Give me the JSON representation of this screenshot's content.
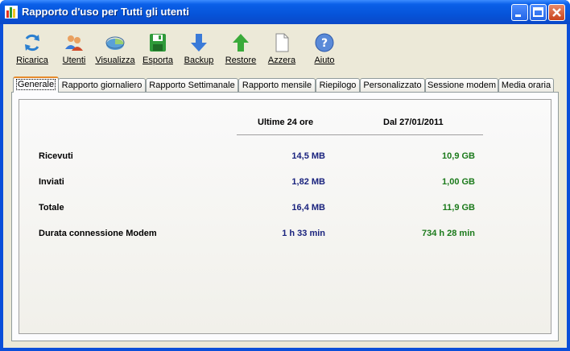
{
  "window": {
    "title": "Rapporto d'uso per Tutti gli utenti"
  },
  "toolbar": [
    {
      "label": "Ricarica",
      "icon": "refresh-icon"
    },
    {
      "label": "Utenti",
      "icon": "users-icon"
    },
    {
      "label": "Visualizza",
      "icon": "pie-chart-icon"
    },
    {
      "label": "Esporta",
      "icon": "save-icon"
    },
    {
      "label": "Backup",
      "icon": "arrow-down-icon"
    },
    {
      "label": "Restore",
      "icon": "arrow-up-icon"
    },
    {
      "label": "Azzera",
      "icon": "blank-page-icon"
    },
    {
      "label": "Aiuto",
      "icon": "help-icon"
    }
  ],
  "tabs": [
    {
      "label": "Generale",
      "active": true
    },
    {
      "label": "Rapporto giornaliero"
    },
    {
      "label": "Rapporto Settimanale"
    },
    {
      "label": "Rapporto mensile"
    },
    {
      "label": "Riepilogo"
    },
    {
      "label": "Personalizzato"
    },
    {
      "label": "Sessione modem"
    },
    {
      "label": "Media oraria"
    }
  ],
  "report": {
    "col1": "Ultime 24 ore",
    "col2": "Dal 27/01/2011",
    "rows": [
      {
        "label": "Ricevuti",
        "v1": "14,5 MB",
        "v2": "10,9 GB"
      },
      {
        "label": "Inviati",
        "v1": "1,82 MB",
        "v2": "1,00 GB"
      },
      {
        "label": "Totale",
        "v1": "16,4 MB",
        "v2": "11,9 GB"
      },
      {
        "label": "Durata connessione Modem",
        "v1": "1 h 33 min",
        "v2": "734 h 28 min"
      }
    ]
  },
  "colors": {
    "titlebar": "#0654d9",
    "value_blue": "#1a237e",
    "value_green": "#1b7a1b",
    "tab_accent": "#e68b2c"
  }
}
